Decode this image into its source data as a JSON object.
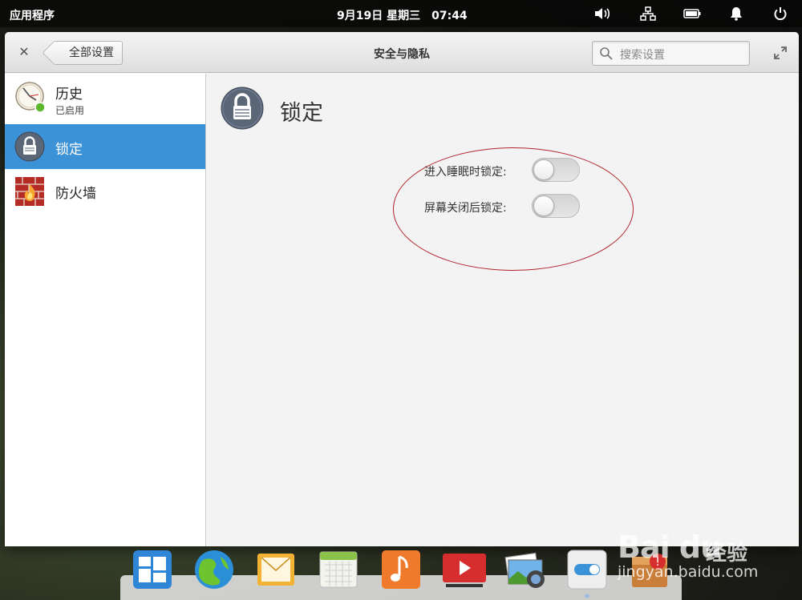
{
  "panel": {
    "apps_label": "应用程序",
    "date": "9月19日 星期三",
    "time": "07:44",
    "indicators": [
      "volume-icon",
      "network-icon",
      "battery-icon",
      "notification-bell-icon",
      "power-icon"
    ]
  },
  "window": {
    "title": "安全与隐私",
    "back_label": "全部设置",
    "close_icon": "close-icon",
    "maximize_icon": "maximize-icon",
    "search": {
      "placeholder": "搜索设置"
    }
  },
  "sidebar": {
    "items": [
      {
        "label": "历史",
        "subtitle": "已启用",
        "icon": "history-clock-icon",
        "active": false
      },
      {
        "label": "锁定",
        "subtitle": "",
        "icon": "lock-icon",
        "active": true
      },
      {
        "label": "防火墙",
        "subtitle": "",
        "icon": "firewall-icon",
        "active": false
      }
    ]
  },
  "main": {
    "heading": "锁定",
    "heading_icon": "lock-icon",
    "settings": [
      {
        "label": "进入睡眠时锁定:",
        "enabled": false
      },
      {
        "label": "屏幕关闭后锁定:",
        "enabled": false
      }
    ]
  },
  "dock": {
    "items": [
      "multitasking-view-icon",
      "web-browser-icon",
      "mail-icon",
      "calendar-icon",
      "music-icon",
      "video-player-icon",
      "photos-icon",
      "system-settings-icon",
      "appcenter-icon"
    ]
  },
  "watermark": {
    "brand": "Bai du",
    "brand_cn": "经验",
    "url": "jingyan.baidu.com"
  },
  "colors": {
    "accent": "#3c92d6",
    "annotation": "#b3202a"
  }
}
